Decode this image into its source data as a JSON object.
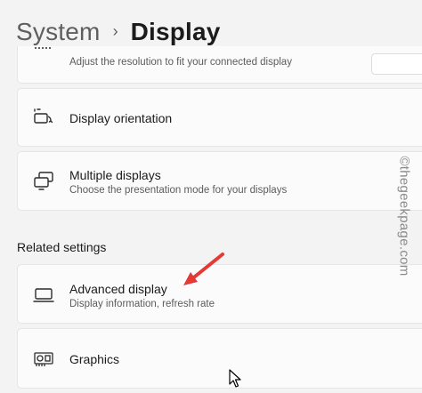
{
  "header": {
    "parent": "System",
    "separator": "›",
    "current": "Display"
  },
  "cards": {
    "resolution": {
      "subtitle": "Adjust the resolution to fit your connected display",
      "icon": "display-resolution-icon"
    },
    "orientation": {
      "title": "Display orientation",
      "icon": "display-orientation-icon"
    },
    "multiple": {
      "title": "Multiple displays",
      "subtitle": "Choose the presentation mode for your displays",
      "icon": "multiple-displays-icon"
    },
    "advanced": {
      "title": "Advanced display",
      "subtitle": "Display information, refresh rate",
      "icon": "laptop-icon"
    },
    "graphics": {
      "title": "Graphics",
      "icon": "graphics-card-icon"
    }
  },
  "related_settings": {
    "heading": "Related settings"
  },
  "watermark": {
    "text": "©thegeekpage.com"
  },
  "colors": {
    "background": "#f3f3f3",
    "card": "#fbfbfb",
    "annotation_arrow": "#e53935"
  }
}
